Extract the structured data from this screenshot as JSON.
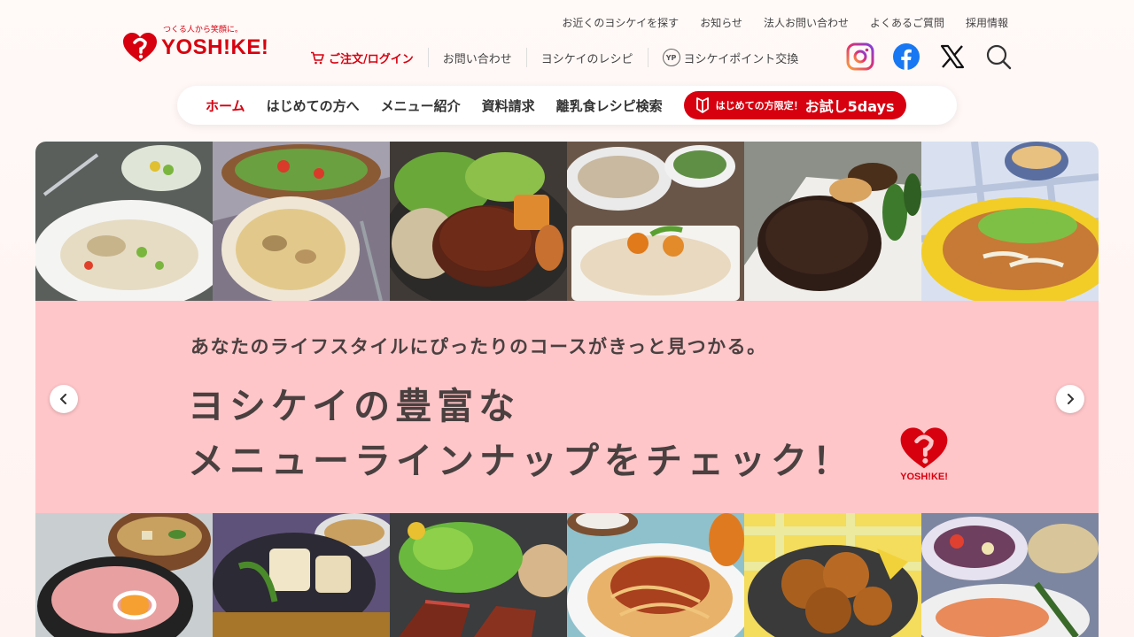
{
  "brand": {
    "tagline": "つくる人から笑顔に。",
    "name": "YOSHIKEI",
    "logo_word": "YOSH!KE!",
    "color": "#d7000f"
  },
  "utility_links": [
    "お近くのヨシケイを探す",
    "お知らせ",
    "法人お問い合わせ",
    "よくあるご質問",
    "採用情報"
  ],
  "main_links": {
    "order": "ご注文/ログイン",
    "contact": "お問い合わせ",
    "recipes": "ヨシケイのレシピ",
    "points_badge": "YP",
    "points": "ヨシケイポイント交換"
  },
  "social": [
    "instagram-icon",
    "facebook-icon",
    "x-icon",
    "search-icon"
  ],
  "global_nav": {
    "items": [
      "ホーム",
      "はじめての方へ",
      "メニュー紹介",
      "資料請求",
      "離乳食レシピ検索"
    ],
    "active": "ホーム",
    "trial_prefix": "はじめての方限定！",
    "trial_label": "お試し5days"
  },
  "hero": {
    "subtitle": "あなたのライフスタイルにぴったりのコースがきっと見つかる。",
    "title_line1": "ヨシケイの豊富な",
    "title_line2": "メニューラインナップをチェック！",
    "band_color": "#ffc6c9",
    "top_images": [
      "chicken-cream-stew-photo",
      "gratin-salad-photo",
      "hamburg-steak-photo",
      "stir-fried-pork-vegetables-photo",
      "grilled-hamburg-photo",
      "pork-ginger-photo"
    ],
    "bottom_images": [
      "miso-soup-tuna-bowl-photo",
      "agedashi-tofu-photo",
      "beef-steak-salad-photo",
      "spaghetti-meat-sauce-photo",
      "fried-chicken-photo",
      "grilled-salmon-photo"
    ]
  }
}
